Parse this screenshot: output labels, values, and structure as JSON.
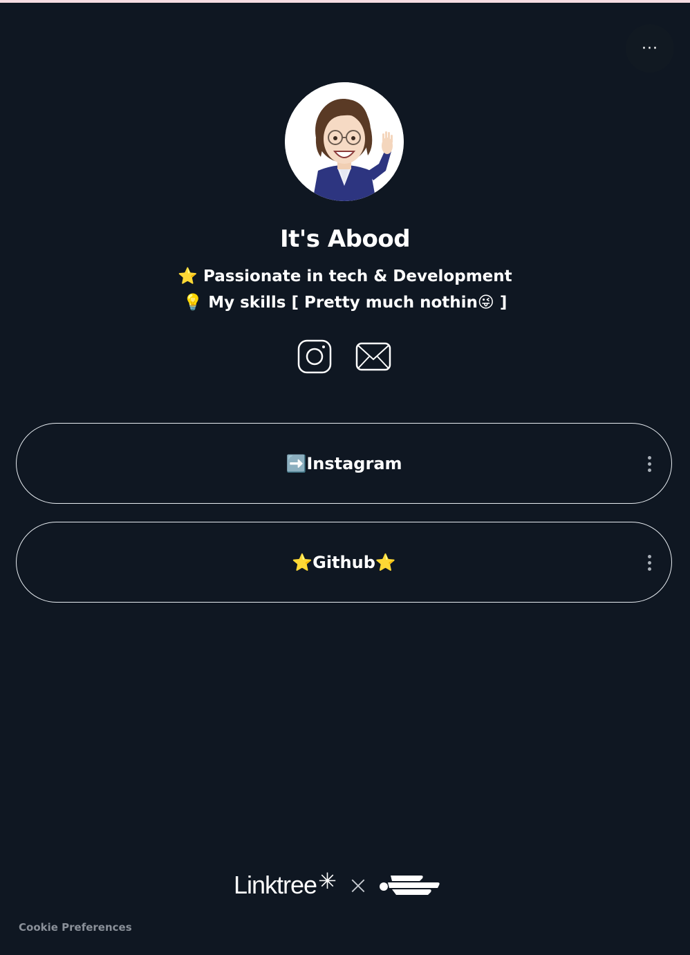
{
  "profile": {
    "name": "It's Abood",
    "bio_line_1": "⭐ Passionate in tech & Development",
    "bio_line_2": "💡 My skills [ Pretty much nothin😜 ]"
  },
  "header": {
    "more_label": "···"
  },
  "social_icons": [
    {
      "icon": "instagram-icon"
    },
    {
      "icon": "email-icon"
    }
  ],
  "links": [
    {
      "label": "➡️Instagram"
    },
    {
      "label": "⭐Github⭐"
    }
  ],
  "footer": {
    "brand": "Linktree",
    "brand_mark": "✳",
    "separator": "×",
    "cookie_label": "Cookie Preferences"
  },
  "colors": {
    "background": "#0f1722",
    "text": "#ffffff",
    "card_border": "#e9eef3",
    "muted": "#8a9099"
  }
}
